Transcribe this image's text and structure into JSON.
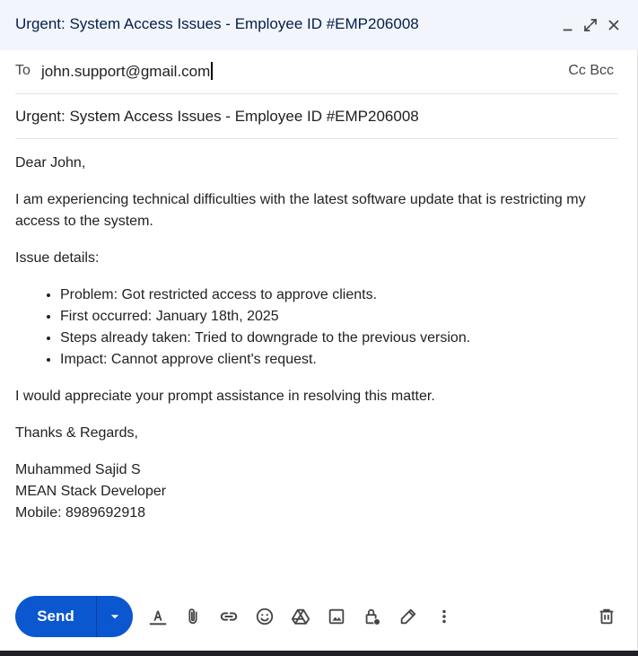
{
  "window": {
    "title": "Urgent: System Access Issues - Employee ID #EMP206008",
    "controls": [
      "minimize-icon",
      "expand-icon",
      "close-icon"
    ]
  },
  "recipients": {
    "to_label": "To",
    "to_value": "john.support@gmail.com",
    "cc_label": "Cc",
    "bcc_label": "Bcc"
  },
  "subject": "Urgent: System Access Issues - Employee ID #EMP206008",
  "body": {
    "greeting": "Dear John,",
    "intro": "I am experiencing technical difficulties with the latest software update that is restricting my access to the system.",
    "details_heading": "Issue details:",
    "details": [
      "Problem: Got restricted access to approve clients.",
      "First occurred: January 18th, 2025",
      "Steps already taken: Tried to downgrade to the previous version.",
      "Impact: Cannot approve client's request."
    ],
    "closing_request": "I would appreciate your prompt assistance in resolving this matter.",
    "signoff": "Thanks & Regards,",
    "signature": {
      "name": "Muhammed Sajid S",
      "role": "MEAN Stack Developer",
      "mobile": "Mobile: 8989692918"
    }
  },
  "toolbar": {
    "send_label": "Send",
    "icons": [
      "formatting-icon",
      "attach-icon",
      "link-icon",
      "emoji-icon",
      "drive-icon",
      "photo-icon",
      "confidential-lock-icon",
      "signature-pen-icon",
      "more-options-icon",
      "discard-trash-icon"
    ]
  },
  "colors": {
    "titlebar_bg": "#f2f6fc",
    "send_button": "#0b57d0",
    "title_text": "#041e49"
  }
}
